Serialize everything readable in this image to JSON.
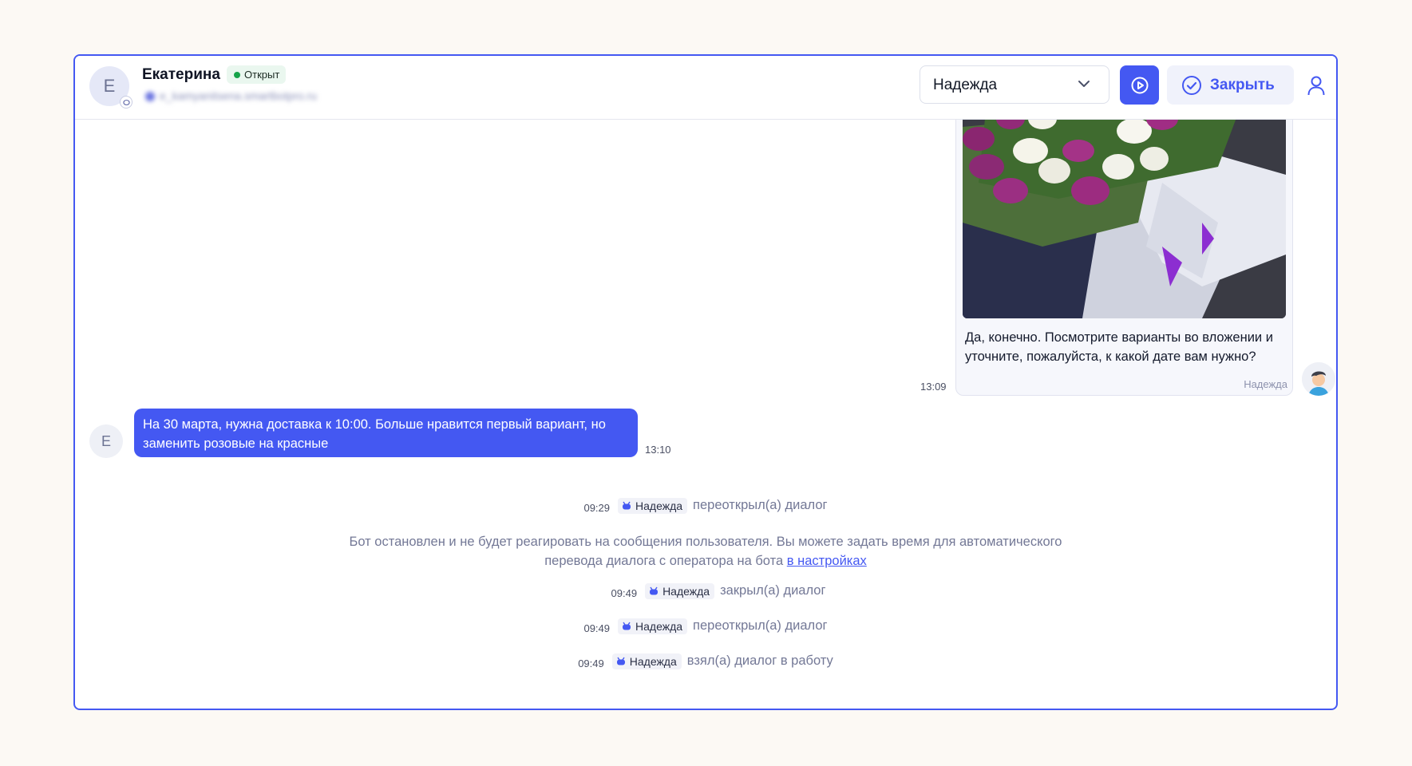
{
  "header": {
    "avatar_letter": "Е",
    "contact_name": "Екатерина",
    "status": "Открыт",
    "contact_email": "e_kamyanitsena.smartbotpro.ru",
    "assignee_select": "Надежда",
    "close_button": "Закрыть"
  },
  "messages": {
    "agent": {
      "text": "Да, конечно. Посмотрите варианты во вложении и уточните, пожалуйста, к какой дате вам нужно?",
      "sender": "Надежда",
      "time": "13:09"
    },
    "user": {
      "avatar_letter": "Е",
      "text": "На 30 марта, нужна доставка к 10:00. Больше нравится первый вариант, но заменить розовые на красные",
      "time": "13:10"
    }
  },
  "events": [
    {
      "time": "09:29",
      "actor": "Надежда",
      "action": "переоткрыл(а) диалог"
    },
    {
      "time": "09:49",
      "actor": "Надежда",
      "action": "закрыл(а) диалог"
    },
    {
      "time": "09:49",
      "actor": "Надежда",
      "action": "переоткрыл(а) диалог"
    },
    {
      "time": "09:49",
      "actor": "Надежда",
      "action": "взял(а) диалог в работу"
    }
  ],
  "notice": {
    "text": "Бот остановлен и не будет реагировать на сообщения пользователя. Вы можете задать время для автоматического перевода диалога с оператора на бота",
    "link": "в настройках"
  },
  "colors": {
    "accent": "#4458f2",
    "status_green": "#17a34a",
    "background": "#fcf9f4"
  },
  "icons": [
    "chat-icon",
    "chevron-down-icon",
    "play-icon",
    "check-circle-icon",
    "user-icon",
    "bot-icon"
  ]
}
